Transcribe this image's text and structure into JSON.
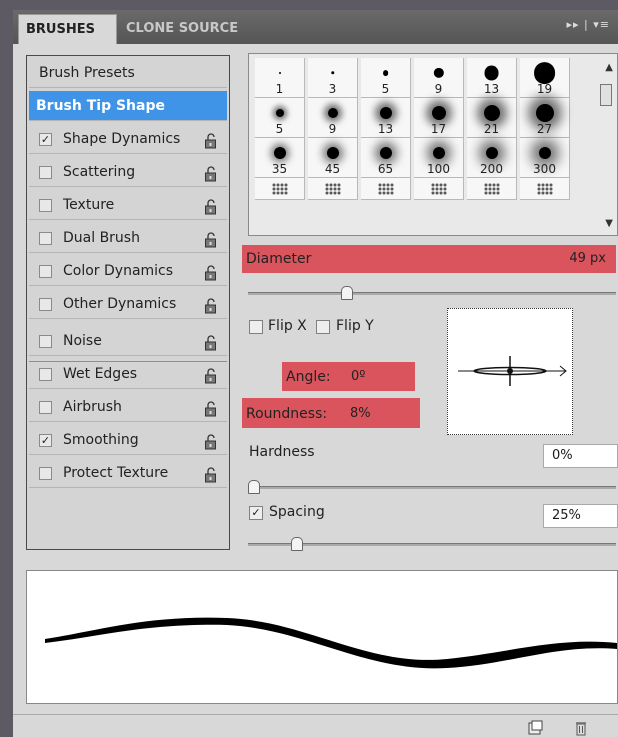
{
  "tabs": {
    "brushes": "BRUSHES",
    "clone_source": "CLONE SOURCE"
  },
  "panel_menu": "▸▸ | ▾≡",
  "left_list": {
    "presets": "Brush Presets",
    "tip_shape": "Brush Tip Shape",
    "items": [
      {
        "label": "Shape Dynamics",
        "checked": true
      },
      {
        "label": "Scattering",
        "checked": false
      },
      {
        "label": "Texture",
        "checked": false
      },
      {
        "label": "Dual Brush",
        "checked": false
      },
      {
        "label": "Color Dynamics",
        "checked": false
      },
      {
        "label": "Other Dynamics",
        "checked": false
      },
      {
        "label": "Noise",
        "checked": false
      },
      {
        "label": "Wet Edges",
        "checked": false
      },
      {
        "label": "Airbrush",
        "checked": false
      },
      {
        "label": "Smoothing",
        "checked": true
      },
      {
        "label": "Protect Texture",
        "checked": false
      }
    ],
    "check_mark": "✓"
  },
  "thumbnails": {
    "rows": [
      [
        "1",
        "3",
        "5",
        "9",
        "13",
        "19"
      ],
      [
        "5",
        "9",
        "13",
        "17",
        "21",
        "27"
      ],
      [
        "35",
        "45",
        "65",
        "100",
        "200",
        "300"
      ],
      [
        "",
        "",
        "",
        "",
        "",
        ""
      ]
    ]
  },
  "diameter": {
    "label": "Diameter",
    "value": "49 px",
    "slider_fraction": 0.26
  },
  "flip": {
    "x_label": "Flip X",
    "y_label": "Flip Y"
  },
  "angle": {
    "label": "Angle:",
    "value": "0º"
  },
  "roundness": {
    "label": "Roundness:",
    "value": "8%"
  },
  "hardness": {
    "label": "Hardness",
    "value": "0%",
    "slider_fraction": 0.0
  },
  "spacing": {
    "label": "Spacing",
    "value": "25%",
    "checked": true,
    "slider_fraction": 0.12
  },
  "colors": {
    "highlight_red": "#d9545d",
    "selected_blue": "#3f94e8"
  }
}
